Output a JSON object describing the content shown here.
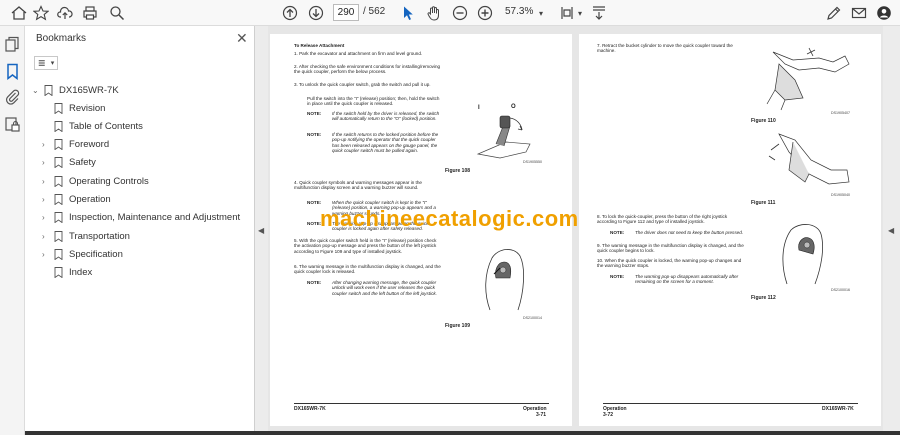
{
  "toolbar": {
    "page_current": "290",
    "page_total": "/ 562",
    "zoom": "57.3%"
  },
  "bookmarks": {
    "title": "Bookmarks",
    "root": "DX165WR-7K",
    "items": [
      {
        "label": "Revision",
        "expandable": false
      },
      {
        "label": "Table of Contents",
        "expandable": false
      },
      {
        "label": "Foreword",
        "expandable": true
      },
      {
        "label": "Safety",
        "expandable": true
      },
      {
        "label": "Operating Controls",
        "expandable": true
      },
      {
        "label": "Operation",
        "expandable": true
      },
      {
        "label": "Inspection, Maintenance and Adjustment",
        "expandable": true
      },
      {
        "label": "Transportation",
        "expandable": true
      },
      {
        "label": "Specification",
        "expandable": true
      },
      {
        "label": "Index",
        "expandable": false
      }
    ]
  },
  "page_left": {
    "heading": "To Release Attachment",
    "s1": "1.   Park the excavator and attachment on firm and level ground.",
    "s2": "2.   After checking the safe environment conditions for installing/removing the quick coupler, perform the below process.",
    "s3": "3.   To unlock the quick coupler switch, grab the switch and pull it up.",
    "s3b": "Pull the switch into the \"I\" (release) position; then, hold the switch in place until the quick coupler is released.",
    "note1_label": "NOTE:",
    "note1": "If the switch held by the driver is released, the switch will automatically return to the \"O\" (locked) position.",
    "note2_label": "NOTE:",
    "note2": "If the switch returns to the locked position before the pop-up notifying the operator that the quick coupler has been released appears on the gauge panel, the quick coupler switch must be pulled again.",
    "fig108": "Figure 108",
    "fig108_code": "DS1905550",
    "fig108_i": "I",
    "fig108_o": "O",
    "s4": "4.   Quick coupler symbols and warning messages appear in the multifunction display screen and a warning buzzer will sound.",
    "note3_label": "NOTE:",
    "note3": "When the quick coupler switch is kept in the \"I\" (release) position, a warning pop-up appears and a warning buzzer sounds.",
    "note4_label": "NOTE:",
    "note4": "The warning pop-up disappears when the quick coupler is locked again after safety released.",
    "s5": "5.   With the quick coupler switch held in the \"I\" (release) position check the activation pop-up message and press the button of the left joystick according to Figure 109 and type of installed joystick.",
    "s6": "6.   The warning message in the multifunction display is changed, and the quick coupler lock is released.",
    "note5_label": "NOTE:",
    "note5": "After changing warning message, the quick coupler unlock will work even if the user releases the quick coupler switch and the left button of the left joystick.",
    "fig109": "Figure 109",
    "fig109_code": "DS2100014",
    "footer_left": "DX165WR-7K",
    "footer_right": "Operation",
    "footer_page": "3-71"
  },
  "page_right": {
    "s7": "7.   Retract the bucket cylinder to move the quick coupler toward the machine.",
    "fig110": "Figure 110",
    "fig110_code": "DS1905407",
    "fig111": "Figure 111",
    "fig111_code": "DS1905040",
    "s8": "8.   To lock the quick-coupler, press the button of the right joystick according to Figure 112 and type of installed joystick.",
    "note6_label": "NOTE:",
    "note6": "The driver does not need to keep the button pressed.",
    "s9": "9.   The warning message in the multifunction display is changed, and the quick coupler begins to lock.",
    "s10": "10.  When the quick coupler is locked, the warning pop-up changes and the warning buzzer stops.",
    "note7_label": "NOTE:",
    "note7": "The warning pop-up disappears automatically after remaining on the screen for a moment.",
    "fig112": "Figure 112",
    "fig112_code": "DS2100016",
    "footer_left": "Operation",
    "footer_page": "3-72",
    "footer_right": "DX165WR-7K"
  },
  "watermark": "machineecatalogic.com"
}
